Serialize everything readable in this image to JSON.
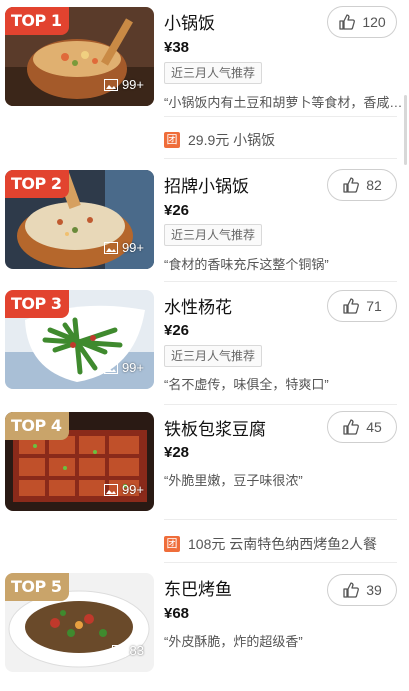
{
  "colors": {
    "hot_badge": "#e2432f",
    "gold_badge": "#c9a46a",
    "deal_badge": "#ef6d3a"
  },
  "items": [
    {
      "rank": "TOP 1",
      "name": "小锅饭",
      "price": "¥38",
      "tag": "近三月人气推荐",
      "quote": "“小锅饭内有土豆和胡萝卜等食材，香咸…",
      "likes": "120",
      "photos": "99+",
      "deal_icon": "团",
      "deal_text": "29.9元 小锅饭"
    },
    {
      "rank": "TOP 2",
      "name": "招牌小锅饭",
      "price": "¥26",
      "tag": "近三月人气推荐",
      "quote": "“食材的香味充斥这整个铜锅”",
      "likes": "82",
      "photos": "99+"
    },
    {
      "rank": "TOP 3",
      "name": "水性杨花",
      "price": "¥26",
      "tag": "近三月人气推荐",
      "quote": "“名不虚传，味俱全，特爽口”",
      "likes": "71",
      "photos": "99+"
    },
    {
      "rank": "TOP 4",
      "name": "铁板包浆豆腐",
      "price": "¥28",
      "quote": "“外脆里嫩，豆子味很浓”",
      "likes": "45",
      "photos": "99+",
      "deal_icon": "团",
      "deal_text": "108元 云南特色纳西烤鱼2人餐"
    },
    {
      "rank": "TOP 5",
      "name": "东巴烤鱼",
      "price": "¥68",
      "quote": "“外皮酥脆，炸的超级香”",
      "likes": "39",
      "photos": "83"
    }
  ]
}
